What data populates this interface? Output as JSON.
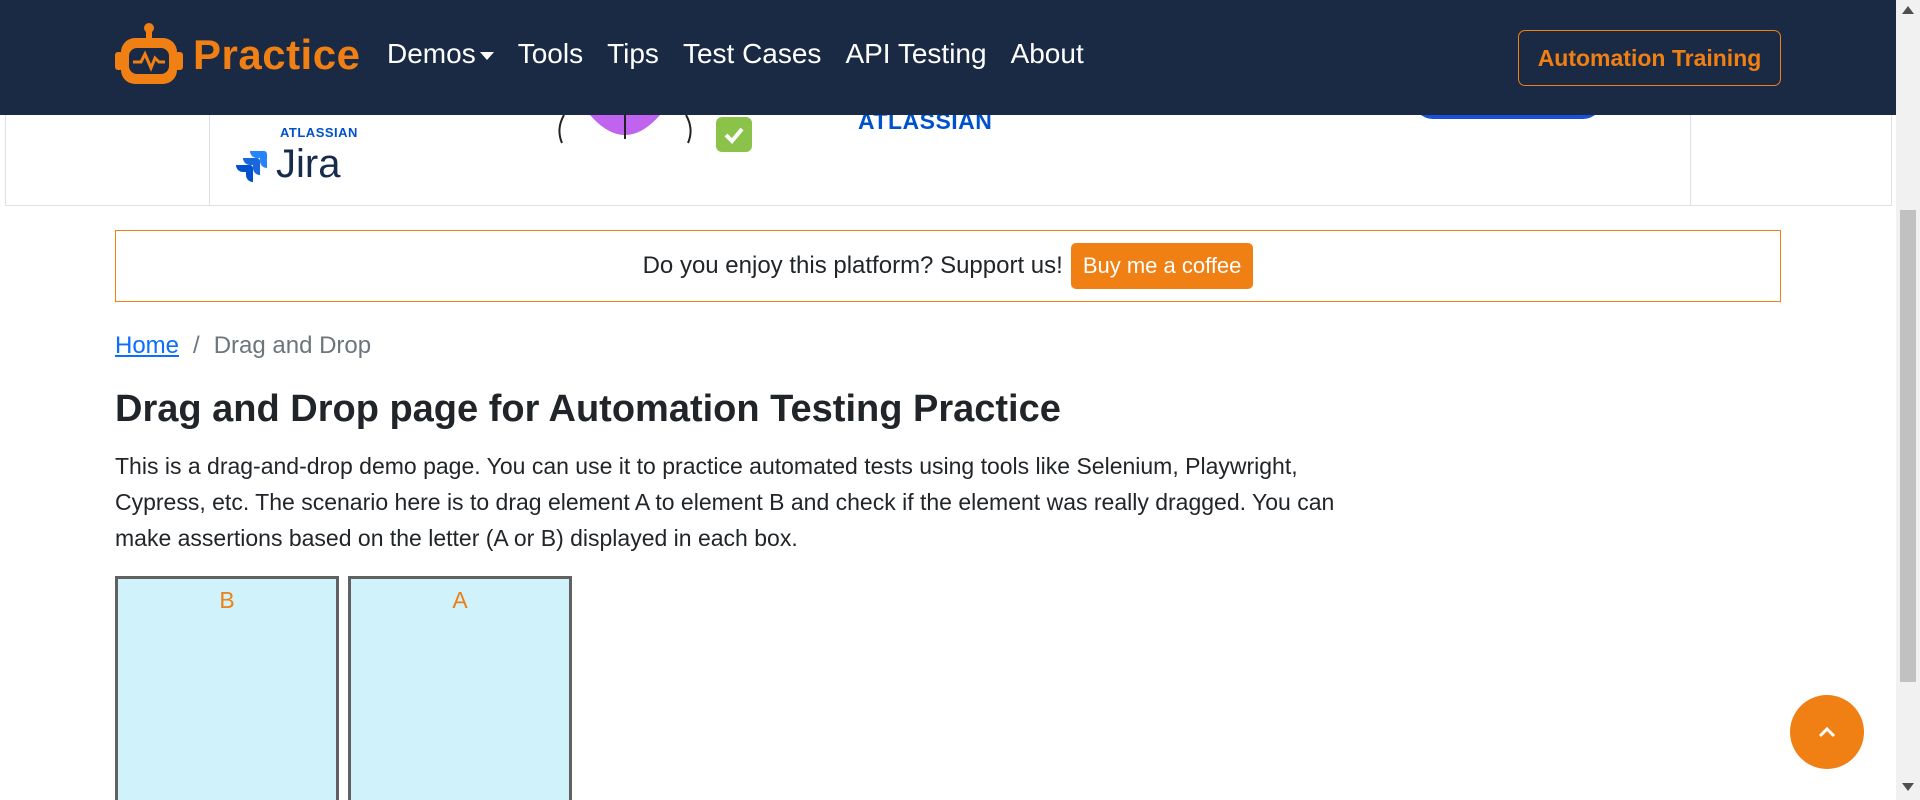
{
  "navbar": {
    "brand": "Practice",
    "links": [
      {
        "label": "Demos",
        "has_dropdown": true
      },
      {
        "label": "Tools"
      },
      {
        "label": "Tips"
      },
      {
        "label": "Test Cases"
      },
      {
        "label": "API Testing"
      },
      {
        "label": "About"
      }
    ],
    "cta_label": "Automation Training"
  },
  "banner": {
    "jira_brand_small": "ATLASSIAN",
    "jira_text": "Jira",
    "atlassian_text": "ATLASSIAN"
  },
  "support": {
    "text": "Do you enjoy this platform? Support us!",
    "button_label": "Buy me a coffee"
  },
  "breadcrumb": {
    "home": "Home",
    "separator": "/",
    "current": "Drag and Drop"
  },
  "page": {
    "title": "Drag and Drop page for Automation Testing Practice",
    "description": "This is a drag-and-drop demo page. You can use it to practice automated tests using tools like Selenium, Playwright, Cypress, etc. The scenario here is to drag element A to element B and check if the element was really dragged. You can make assertions based on the letter (A or B) displayed in each box."
  },
  "dnd": {
    "boxes": [
      {
        "label": "B"
      },
      {
        "label": "A"
      }
    ]
  },
  "colors": {
    "navbar_bg": "#1a2a44",
    "accent": "#f07f14",
    "box_bg": "#cff2fb",
    "link": "#0d6efd"
  }
}
